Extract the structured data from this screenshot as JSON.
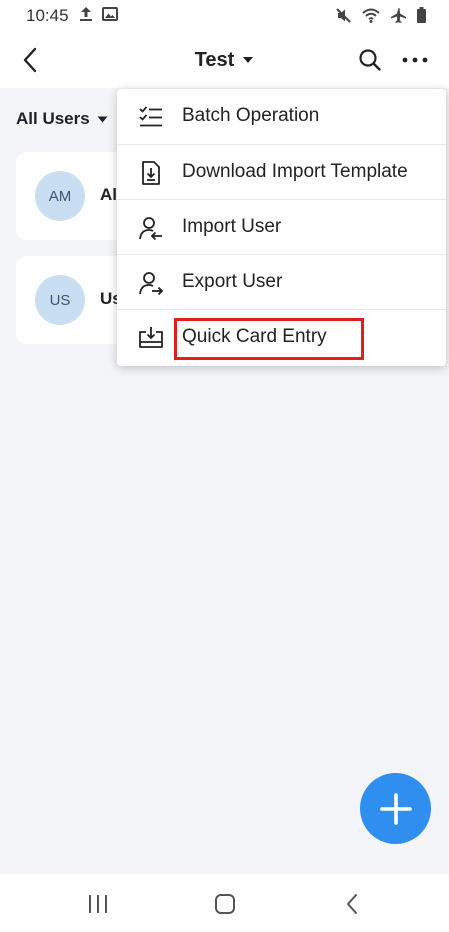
{
  "status_bar": {
    "time": "10:45",
    "left_icons": [
      "upload-icon",
      "image-icon"
    ],
    "right_icons": [
      "mute-icon",
      "wifi-icon",
      "airplane-icon",
      "battery-icon"
    ]
  },
  "header": {
    "title": "Test",
    "back_icon": "back-arrow-icon",
    "title_dropdown_icon": "caret-down-icon",
    "search_icon": "search-icon",
    "more_icon": "more-icon"
  },
  "filter": {
    "label": "All Users"
  },
  "users": [
    {
      "initials": "AM",
      "name": "Al"
    },
    {
      "initials": "US",
      "name": "Us"
    }
  ],
  "menu": {
    "items": [
      {
        "label": "Batch Operation",
        "icon": "checklist-icon"
      },
      {
        "label": "Download Import Template",
        "icon": "download-file-icon"
      },
      {
        "label": "Import User",
        "icon": "import-user-icon"
      },
      {
        "label": "Export User",
        "icon": "export-user-icon"
      },
      {
        "label": "Quick Card Entry",
        "icon": "card-download-icon",
        "highlighted": true
      }
    ],
    "highlight_color": "#e0201c"
  },
  "fab": {
    "icon": "plus-icon",
    "color": "#2f8ff0"
  },
  "nav_bar": {
    "icons": [
      "recents-icon",
      "home-icon",
      "back-icon"
    ]
  }
}
